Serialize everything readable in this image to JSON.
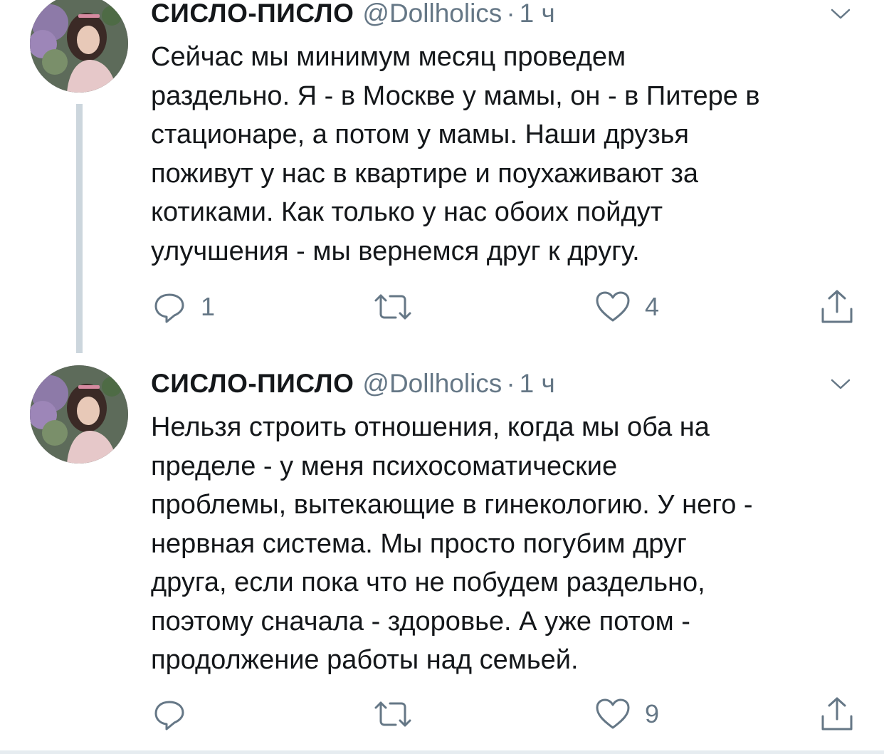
{
  "tweets": [
    {
      "name": "СИСЛО-ПИСЛО",
      "handle": "@Dollholics",
      "separator": "·",
      "time": "1 ч",
      "lines": [
        "Сейчас мы минимум месяц проведем",
        "раздельно. Я - в Москве у мамы, он - в Питере в",
        "стационаре, а потом у мамы. Наши друзья",
        "поживут у нас в квартире и поухаживают за",
        "котиками. Как только у нас обоих пойдут",
        "улучшения - мы вернемся друг к другу."
      ],
      "reply_count": "1",
      "retweet_count": "",
      "like_count": "4"
    },
    {
      "name": "СИСЛО-ПИСЛО",
      "handle": "@Dollholics",
      "separator": "·",
      "time": "1 ч",
      "lines": [
        "Нельзя строить отношения, когда мы оба на",
        "пределе - у меня психосоматические",
        "проблемы, вытекающие в гинекологию. У него -",
        "нервная система. Мы просто погубим друг",
        "друга, если пока что не побудем раздельно,",
        "поэтому сначала - здоровье. А уже потом -",
        "продолжение работы над семьей."
      ],
      "reply_count": "",
      "retweet_count": "",
      "like_count": "9"
    }
  ],
  "icons": {
    "reply": "reply-icon",
    "retweet": "retweet-icon",
    "like": "heart-icon",
    "share": "share-icon",
    "menu": "chevron-down-icon"
  },
  "colors": {
    "text": "#14171a",
    "muted": "#657786",
    "thread_line": "#ccd6dd"
  }
}
